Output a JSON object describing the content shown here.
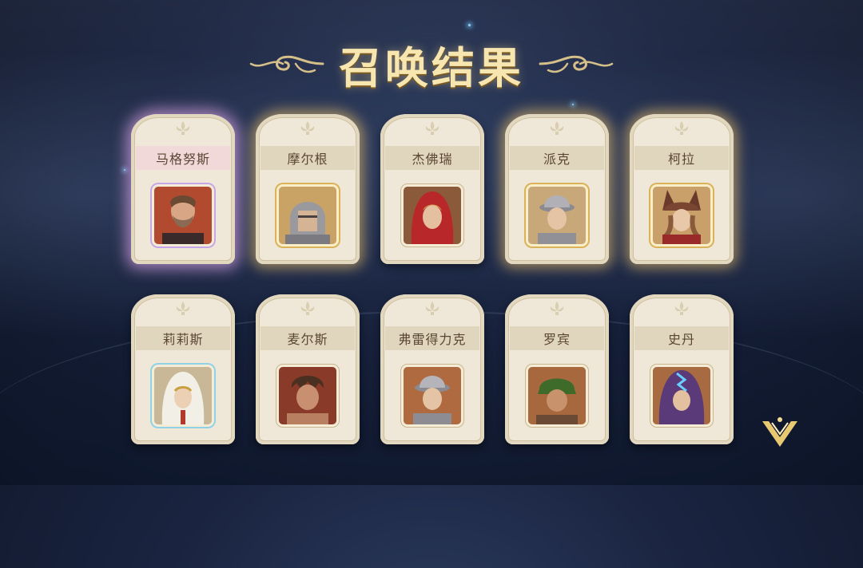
{
  "header": {
    "title": "召唤结果"
  },
  "results": [
    {
      "name": "马格努斯",
      "rarity_glow": "purple",
      "portrait": "bearded-warrior-portrait"
    },
    {
      "name": "摩尔根",
      "rarity_glow": "gold",
      "portrait": "helmeted-knight-portrait"
    },
    {
      "name": "杰佛瑞",
      "rarity_glow": "none",
      "portrait": "red-hooded-portrait"
    },
    {
      "name": "派克",
      "rarity_glow": "gold",
      "portrait": "kettle-helmet-soldier-portrait"
    },
    {
      "name": "柯拉",
      "rarity_glow": "gold",
      "portrait": "horned-hat-girl-portrait"
    },
    {
      "name": "莉莉斯",
      "rarity_glow": "none",
      "portrait": "white-hood-nun-portrait"
    },
    {
      "name": "麦尔斯",
      "rarity_glow": "none",
      "portrait": "rugged-man-portrait"
    },
    {
      "name": "弗雷得力克",
      "rarity_glow": "none",
      "portrait": "kettle-helmet-soldier-portrait"
    },
    {
      "name": "罗宾",
      "rarity_glow": "none",
      "portrait": "green-bandana-portrait"
    },
    {
      "name": "史丹",
      "rarity_glow": "none",
      "portrait": "purple-hood-portrait"
    }
  ],
  "controls": {
    "next_icon": "chevron-down-icon"
  },
  "colors": {
    "title": "#f7e6b0",
    "card": "#efe8d8",
    "name_band": "#e0d5bd",
    "purple_glow": "#e6aaf0",
    "gold_glow": "#ffcd6e"
  }
}
